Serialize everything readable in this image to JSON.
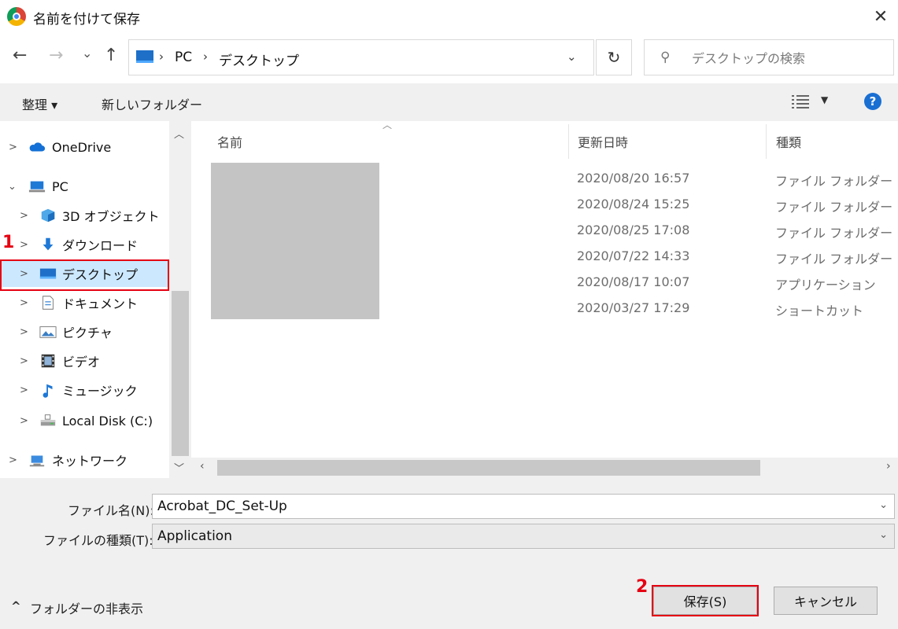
{
  "window": {
    "title": "名前を付けて保存",
    "close_glyph": "✕"
  },
  "nav": {
    "back_glyph": "←",
    "forward_glyph": "→",
    "recent_glyph": "⌄",
    "up_glyph": "↑",
    "breadcrumb": [
      "PC",
      "デスクトップ"
    ],
    "sep_glyph": "›",
    "refresh_glyph": "↻",
    "search_placeholder": "デスクトップの検索"
  },
  "toolbar": {
    "organize": "整理 ▾",
    "new_folder": "新しいフォルダー",
    "help": "?"
  },
  "tree": [
    {
      "label": "OneDrive",
      "icon": "cloud-icon",
      "chevron": ">"
    },
    {
      "label": "PC",
      "icon": "computer-icon",
      "chevron": "⌄"
    },
    {
      "label": "3D オブジェクト",
      "icon": "cube-icon",
      "chevron": ">"
    },
    {
      "label": "ダウンロード",
      "icon": "download-icon",
      "chevron": ">"
    },
    {
      "label": "デスクトップ",
      "icon": "desktop-icon",
      "chevron": ">"
    },
    {
      "label": "ドキュメント",
      "icon": "document-icon",
      "chevron": ">"
    },
    {
      "label": "ピクチャ",
      "icon": "picture-icon",
      "chevron": ">"
    },
    {
      "label": "ビデオ",
      "icon": "video-icon",
      "chevron": ">"
    },
    {
      "label": "ミュージック",
      "icon": "music-icon",
      "chevron": ">"
    },
    {
      "label": "Local Disk (C:)",
      "icon": "disk-icon",
      "chevron": ">"
    },
    {
      "label": "ネットワーク",
      "icon": "network-icon",
      "chevron": ">"
    }
  ],
  "columns": {
    "name": "名前",
    "modified": "更新日時",
    "type": "種類"
  },
  "files": [
    {
      "modified": "2020/08/20 16:57",
      "type": "ファイル フォルダー"
    },
    {
      "modified": "2020/08/24 15:25",
      "type": "ファイル フォルダー"
    },
    {
      "modified": "2020/08/25 17:08",
      "type": "ファイル フォルダー"
    },
    {
      "modified": "2020/07/22 14:33",
      "type": "ファイル フォルダー"
    },
    {
      "modified": "2020/08/17 10:07",
      "type": "アプリケーション"
    },
    {
      "modified": "2020/03/27 17:29",
      "type": "ショートカット"
    }
  ],
  "form": {
    "filename_label": "ファイル名(N):",
    "filename_value": "Acrobat_DC_Set-Up",
    "filetype_label": "ファイルの種類(T):",
    "filetype_value": "Application",
    "dropdown_glyph": "⌄"
  },
  "footer": {
    "hide_folders": "フォルダーの非表示",
    "hide_glyph": "^",
    "save": "保存(S)",
    "cancel": "キャンセル"
  },
  "annotations": {
    "step1": "1",
    "step2": "2",
    "highlight_color": "#e60012"
  }
}
